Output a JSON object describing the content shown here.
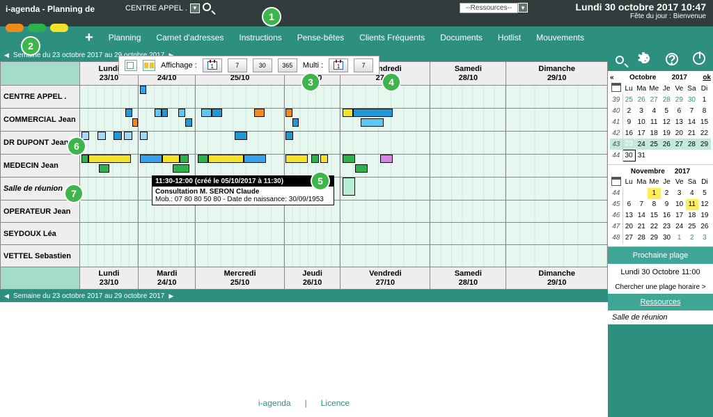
{
  "app": {
    "title": "i-agenda - Planning de",
    "center": "CENTRE APPEL .",
    "resources_dd": "--Ressources--"
  },
  "clock": {
    "date": "Lundi 30 octobre 2017  10:47",
    "fete": "Fête du jour : Bienvenue"
  },
  "nav": {
    "plus": "+",
    "items": [
      "Planning",
      "Carnet d'adresses",
      "Instructions",
      "Pense-bêtes",
      "Clients Fréquents",
      "Documents",
      "Hotlist",
      "Mouvements"
    ]
  },
  "weeklabel": "Semaine du 23 octobre 2017 au 29 octobre 2017",
  "days": [
    {
      "name": "Lundi",
      "date": "23/10"
    },
    {
      "name": "Mardi",
      "date": "24/10"
    },
    {
      "name": "Mercredi",
      "date": "25/10"
    },
    {
      "name": "Jeudi",
      "date": "26/10"
    },
    {
      "name": "Vendredi",
      "date": "27/10"
    },
    {
      "name": "Samedi",
      "date": "28/10"
    },
    {
      "name": "Dimanche",
      "date": "29/10"
    }
  ],
  "resources": [
    "CENTRE APPEL .",
    "COMMERCIAL Jean",
    "DR DUPONT Jean",
    "MEDECIN Jean",
    "Salle de réunion",
    "OPERATEUR Jean",
    "SEYDOUX Léa",
    "VETTEL Sebastien"
  ],
  "toolbar": {
    "aff": "Affichage :",
    "multi": "Multi :",
    "d1": "1",
    "d7": "7",
    "d30": "30",
    "d365": "365",
    "m1": "1",
    "m7": "7"
  },
  "tooltip": {
    "hdr": "11:30-12:00 (créé le 05/10/2017 à 11:30)",
    "l1": "Consultation M. SERON Claude",
    "l2": "Mob.: 07 80 80 50 80 - Date de naissance: 30/09/1953"
  },
  "badges": {
    "b1": "1",
    "b2": "2",
    "b3": "3",
    "b4": "4",
    "b5": "5",
    "b6": "6",
    "b7": "7"
  },
  "mini_oct": {
    "month": "Octobre",
    "year": "2017",
    "ok": "ok",
    "days": [
      "Lu",
      "Ma",
      "Me",
      "Je",
      "Ve",
      "Sa",
      "Di"
    ],
    "rows": [
      {
        "wk": "39",
        "d": [
          "25",
          "26",
          "27",
          "28",
          "29",
          "30",
          "1"
        ],
        "ot": [
          0,
          1,
          2,
          3,
          4,
          5
        ]
      },
      {
        "wk": "40",
        "d": [
          "2",
          "3",
          "4",
          "5",
          "6",
          "7",
          "8"
        ]
      },
      {
        "wk": "41",
        "d": [
          "9",
          "10",
          "11",
          "12",
          "13",
          "14",
          "15"
        ]
      },
      {
        "wk": "42",
        "d": [
          "16",
          "17",
          "18",
          "19",
          "20",
          "21",
          "22"
        ]
      },
      {
        "wk": "43",
        "d": [
          "23",
          "24",
          "25",
          "26",
          "27",
          "28",
          "29"
        ],
        "cur": true,
        "today": 0
      },
      {
        "wk": "44",
        "d": [
          "30",
          "31"
        ],
        "sel": 0
      }
    ]
  },
  "mini_nov": {
    "month": "Novembre",
    "year": "2017",
    "days": [
      "Lu",
      "Ma",
      "Me",
      "Je",
      "Ve",
      "Sa",
      "Di"
    ],
    "rows": [
      {
        "wk": "44",
        "d": [
          "",
          "",
          "1",
          "2",
          "3",
          "4",
          "5"
        ],
        "hl": [
          2
        ]
      },
      {
        "wk": "45",
        "d": [
          "6",
          "7",
          "8",
          "9",
          "10",
          "11",
          "12"
        ],
        "hl": [
          5
        ]
      },
      {
        "wk": "46",
        "d": [
          "13",
          "14",
          "15",
          "16",
          "17",
          "18",
          "19"
        ]
      },
      {
        "wk": "47",
        "d": [
          "20",
          "21",
          "22",
          "23",
          "24",
          "25",
          "26"
        ]
      },
      {
        "wk": "48",
        "d": [
          "27",
          "28",
          "29",
          "30",
          "1",
          "2",
          "3"
        ],
        "ot": [
          4,
          5,
          6
        ]
      }
    ]
  },
  "right": {
    "next": "Prochaine plage",
    "when": "Lundi 30 Octobre 11:00",
    "search": "Chercher une plage horaire >",
    "res": "Ressources",
    "room": "Salle de réunion"
  },
  "footer": {
    "a": "i-agenda",
    "sep": "|",
    "b": "Licence"
  }
}
